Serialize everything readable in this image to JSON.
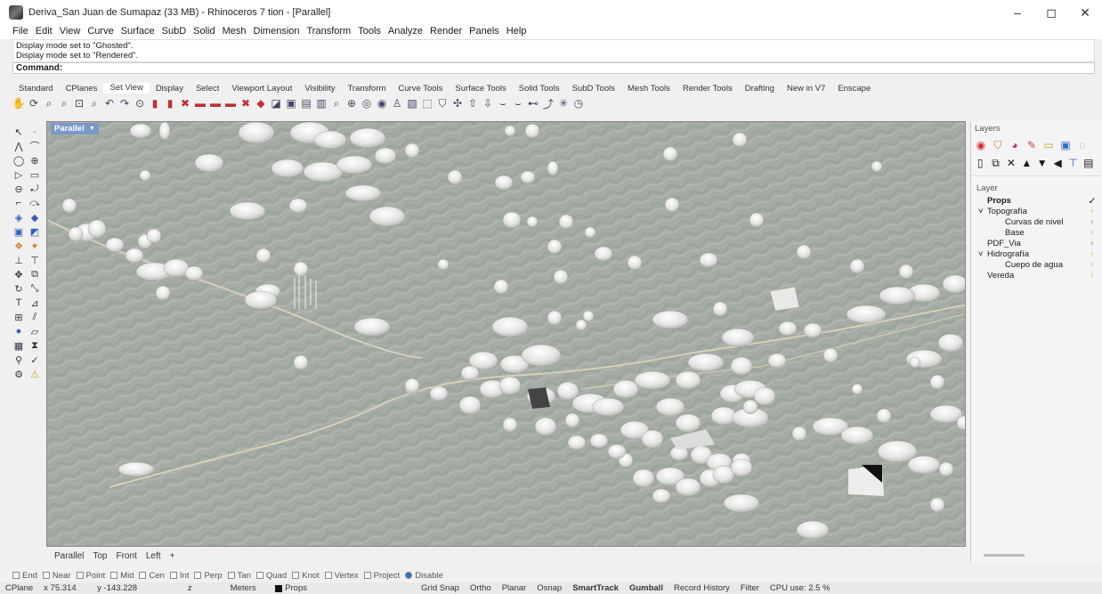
{
  "window": {
    "title": "Deriva_San Juan de Sumapaz (33 MB) - Rhinoceros 7 tion - [Parallel]",
    "minimize_glyph": "–",
    "maximize_glyph": "◻",
    "close_glyph": "✕"
  },
  "menu": [
    "File",
    "Edit",
    "View",
    "Curve",
    "Surface",
    "SubD",
    "Solid",
    "Mesh",
    "Dimension",
    "Transform",
    "Tools",
    "Analyze",
    "Render",
    "Panels",
    "Help"
  ],
  "history": [
    "Display mode set to \"Ghosted\".",
    "Display mode set to \"Rendered\"."
  ],
  "command_label": "Command:",
  "toolbar_tabs": [
    "Standard",
    "CPlanes",
    "Set View",
    "Display",
    "Select",
    "Viewport Layout",
    "Visibility",
    "Transform",
    "Curve Tools",
    "Surface Tools",
    "Solid Tools",
    "SubD Tools",
    "Mesh Tools",
    "Render Tools",
    "Drafting",
    "New in V7",
    "Enscape"
  ],
  "toolbar_tab_active": "Set View",
  "viewport": {
    "label": "Parallel",
    "tabs": [
      "Parallel",
      "Top",
      "Front",
      "Left",
      "+"
    ]
  },
  "layers_panel": {
    "title": "Layers",
    "column_header": "Layer",
    "layers": [
      {
        "name": "Props",
        "current": true,
        "check": "✓",
        "indent": 0,
        "expander": ""
      },
      {
        "name": "Topografía",
        "indent": 0,
        "expander": "˅",
        "bulb_color": "#e0b020"
      },
      {
        "name": "Curvas de nivel",
        "indent": 2,
        "expander": "",
        "bulb_color": "#4a7fd0"
      },
      {
        "name": "Base",
        "indent": 2,
        "expander": "",
        "bulb_color": "#e0b020"
      },
      {
        "name": "PDF_Via",
        "indent": 0,
        "expander": "",
        "bulb_color": "#4a7fd0"
      },
      {
        "name": "Hidrografía",
        "indent": 0,
        "expander": "˅",
        "bulb_color": "#e0b020"
      },
      {
        "name": "Cuepo de agua",
        "indent": 2,
        "expander": "",
        "bulb_color": "#e0b020"
      },
      {
        "name": "Vereda",
        "indent": 0,
        "expander": "",
        "bulb_color": "#e0b020"
      }
    ]
  },
  "osnaps": [
    {
      "label": "End",
      "checked": false
    },
    {
      "label": "Near",
      "checked": false
    },
    {
      "label": "Point",
      "checked": false
    },
    {
      "label": "Mid",
      "checked": false
    },
    {
      "label": "Cen",
      "checked": false
    },
    {
      "label": "Int",
      "checked": false
    },
    {
      "label": "Perp",
      "checked": false
    },
    {
      "label": "Tan",
      "checked": false
    },
    {
      "label": "Quad",
      "checked": false
    },
    {
      "label": "Knot",
      "checked": false
    },
    {
      "label": "Vertex",
      "checked": false
    },
    {
      "label": "Project",
      "checked": false
    },
    {
      "label": "Disable",
      "checked": true
    }
  ],
  "statusbar": {
    "cplane": "CPlane",
    "x": "x 75.314",
    "y": "y -143.228",
    "z": "z",
    "units": "Meters",
    "layer": "Props",
    "grid_snap": "Grid Snap",
    "ortho": "Ortho",
    "planar": "Planar",
    "osnap": "Osnap",
    "smarttrack": "SmartTrack",
    "gumball": "Gumball",
    "record_history": "Record History",
    "filter": "Filter",
    "cpu": "CPU use: 2.5 %"
  },
  "colors": {
    "viewport_bg": "#b8bab6",
    "label_blue": "#7a98c8",
    "terrain_green": "#8fa092"
  }
}
